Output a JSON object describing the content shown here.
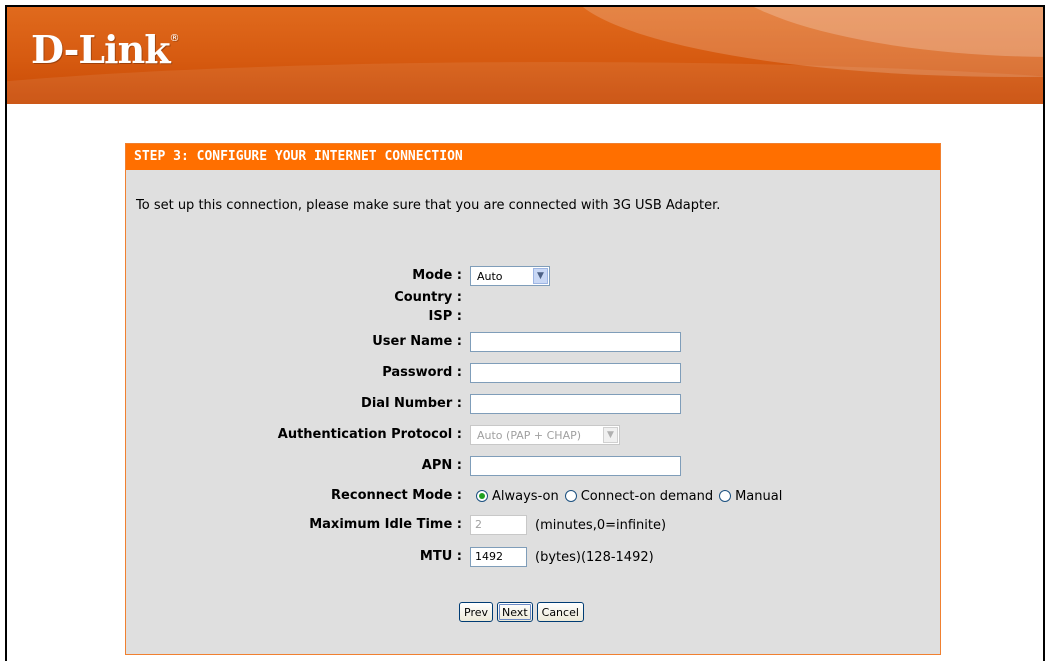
{
  "header": {
    "logo": "D-Link",
    "logo_mark": "®",
    "brand_color": "#d65a10"
  },
  "panel": {
    "title": "STEP 3: CONFIGURE YOUR INTERNET CONNECTION",
    "accent": "#ff6f00",
    "intro": "To set up this connection, please make sure that you are connected with 3G USB Adapter."
  },
  "form": {
    "mode": {
      "label": "Mode :",
      "value": "Auto"
    },
    "country": {
      "label": "Country :"
    },
    "isp": {
      "label": "ISP :"
    },
    "username": {
      "label": "User Name :",
      "value": ""
    },
    "password": {
      "label": "Password :",
      "value": ""
    },
    "dial": {
      "label": "Dial Number :",
      "value": ""
    },
    "auth": {
      "label": "Authentication Protocol :",
      "value": "Auto (PAP + CHAP)"
    },
    "apn": {
      "label": "APN :",
      "value": ""
    },
    "reconnect": {
      "label": "Reconnect Mode :",
      "options": [
        "Always-on",
        "Connect-on demand",
        "Manual"
      ],
      "selected": "Always-on"
    },
    "idle": {
      "label": "Maximum Idle Time :",
      "value": "2",
      "hint": "(minutes,0=infinite)"
    },
    "mtu": {
      "label": "MTU :",
      "value": "1492",
      "hint": "(bytes)(128-1492)"
    }
  },
  "buttons": {
    "prev": "Prev",
    "next": "Next",
    "cancel": "Cancel"
  }
}
